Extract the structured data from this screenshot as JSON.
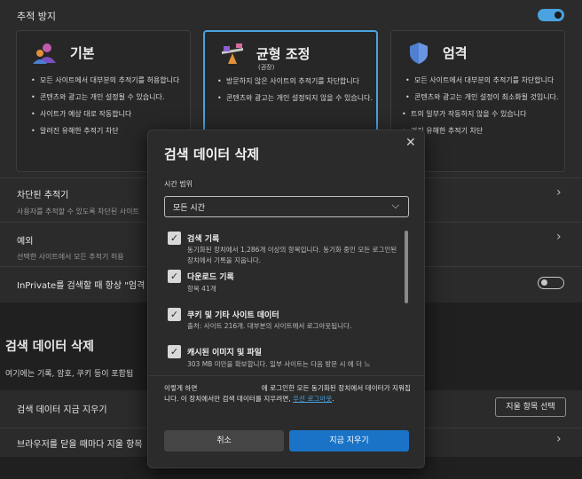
{
  "tracking": {
    "section_title": "추적 방지",
    "toggle_on": true,
    "cards": [
      {
        "title": "기본",
        "subtitle": "",
        "bullets": [
          "모든 사이트에서 대부분의 추적기를 허용합니다",
          "콘텐츠와 광고는 개인 설정될 수 있습니다.",
          "사이트가 예상 대로 작동합니다",
          "알려진 유해한 추적기 차단"
        ]
      },
      {
        "title": "균형 조정",
        "subtitle": "(권장)",
        "bullets": [
          "방문하지 않은 사이트의 추적기를 차단합니다",
          "콘텐츠와 광고는 개인 설정되지 않을 수 있습니다."
        ]
      },
      {
        "title": "엄격",
        "subtitle": "",
        "bullets": [
          "모든 사이트에서 대부분의 추적기를 차단합니다",
          "콘텐츠와 광고는 개인 설정이 최소화될 것입니다.",
          "트의 일부가 작동하지 않을 수 있습니다",
          "려진 유해한 추적기 차단"
        ]
      }
    ]
  },
  "rows": {
    "blocked_title": "차단된 추적기",
    "blocked_desc": "사용자를 추적할 수 있도록 차단된 사이트",
    "exceptions_title": "예외",
    "exceptions_desc": "선택한 사이트에서 모든 추적기 허용",
    "inprivate_title": "InPrivate를 검색할 때 항상 \"엄격",
    "clear_section_title": "검색 데이터 삭제",
    "clear_section_desc": "여기에는 기록, 암호, 쿠키 등이 포함됩",
    "clear_now_title": "검색 데이터 지금 지우기",
    "choose_button": "지울 항목 선택",
    "on_close_title": "브라우저를 닫을 때마다 지울 항목"
  },
  "dialog": {
    "title": "검색 데이터 삭제",
    "time_range_label": "시간 범위",
    "time_range_value": "모든 시간",
    "items": [
      {
        "title": "검색 기록",
        "desc": "동기화된 장치에서 1,286개 이상의 항목입니다. 동기화 중인 모든 로그인된 장치에서 기록을 지웁니다.",
        "checked": true
      },
      {
        "title": "다운로드 기록",
        "desc": "항목 41개",
        "checked": true
      },
      {
        "title": "쿠키 및 기타 사이트 데이터",
        "desc": "출처: 사이트 216개. 대부분의 사이트에서 로그아웃됩니다.",
        "checked": true
      },
      {
        "title": "캐시된 이미지 및 파일",
        "desc": "303 MB 미만을 확보합니다. 일부 사이트는 다음 방문 시 에 더 느",
        "checked": true
      }
    ],
    "note_part1": "이렇게 하면                              에 로그인한 모든 동기화된 장치에서 데이터가 지워집니다. 이 장치에서만 검색 데이터를 지우려면, ",
    "note_link": "우선 로그아웃",
    "note_end": ".",
    "cancel_label": "취소",
    "clear_label": "지금 지우기"
  }
}
